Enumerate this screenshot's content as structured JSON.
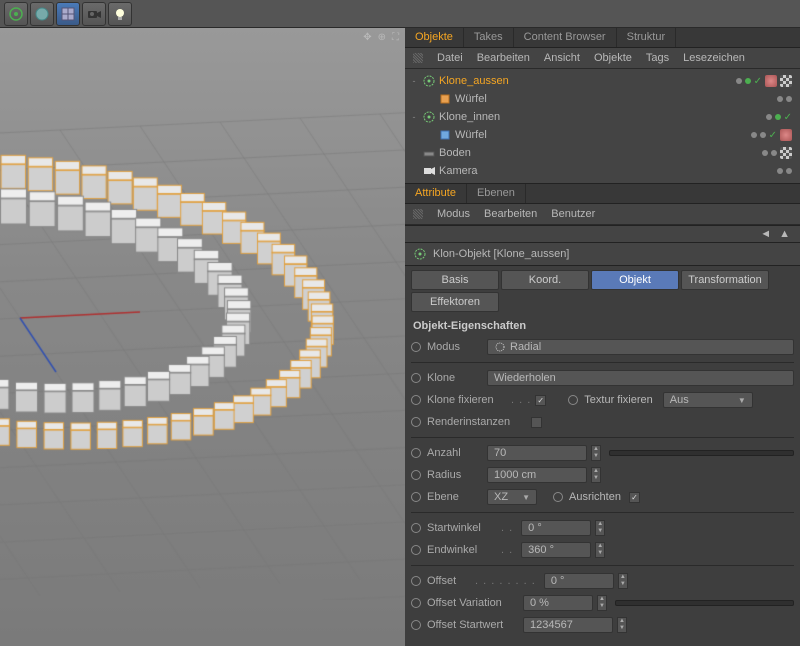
{
  "toolbar_icons": [
    "atom-icon",
    "sphere-icon",
    "grid-icon",
    "camera-icon",
    "light-icon"
  ],
  "tabs_objects": [
    "Objekte",
    "Takes",
    "Content Browser",
    "Struktur"
  ],
  "tabs_objects_active": 0,
  "obj_menu": [
    "Datei",
    "Bearbeiten",
    "Ansicht",
    "Objekte",
    "Tags",
    "Lesezeichen"
  ],
  "tree": [
    {
      "indent": 0,
      "toggle": "-",
      "icon": "cloner",
      "label": "Klone_aussen",
      "sel": true,
      "ctrl": [
        "gray",
        "green",
        "check"
      ],
      "tags": [
        "coffee",
        "checker"
      ]
    },
    {
      "indent": 1,
      "toggle": "",
      "icon": "cube-orange",
      "label": "Würfel",
      "sel": false,
      "ctrl": [
        "gray",
        "gray"
      ],
      "tags": []
    },
    {
      "indent": 0,
      "toggle": "-",
      "icon": "cloner",
      "label": "Klone_innen",
      "sel": false,
      "ctrl": [
        "gray",
        "green",
        "check"
      ],
      "tags": []
    },
    {
      "indent": 1,
      "toggle": "",
      "icon": "cube-blue",
      "label": "Würfel",
      "sel": false,
      "ctrl": [
        "gray",
        "gray",
        "check"
      ],
      "tags": [
        "coffee"
      ]
    },
    {
      "indent": 0,
      "toggle": "",
      "icon": "floor",
      "label": "Boden",
      "sel": false,
      "ctrl": [
        "gray",
        "gray"
      ],
      "tags": [
        "checker"
      ]
    },
    {
      "indent": 0,
      "toggle": "",
      "icon": "camera",
      "label": "Kamera",
      "sel": false,
      "ctrl": [
        "gray",
        "gray"
      ],
      "tags": []
    }
  ],
  "attr_tabs": [
    "Attribute",
    "Ebenen"
  ],
  "attr_tabs_active": 0,
  "attr_menu": [
    "Modus",
    "Bearbeiten",
    "Benutzer"
  ],
  "obj_header": "Klon-Objekt [Klone_aussen]",
  "prop_tabs": [
    "Basis",
    "Koord.",
    "Objekt",
    "Transformation",
    "Effektoren"
  ],
  "prop_tabs_active": 2,
  "section": "Objekt-Eigenschaften",
  "props": {
    "modus": {
      "label": "Modus",
      "value": "Radial"
    },
    "klone": {
      "label": "Klone",
      "value": "Wiederholen"
    },
    "klone_fix": {
      "label": "Klone fixieren",
      "checked": true
    },
    "textur_fix": {
      "label": "Textur fixieren",
      "value": "Aus"
    },
    "renderinst": {
      "label": "Renderinstanzen",
      "checked": false
    },
    "anzahl": {
      "label": "Anzahl",
      "value": "70"
    },
    "radius": {
      "label": "Radius",
      "value": "1000 cm"
    },
    "ebene": {
      "label": "Ebene",
      "value": "XZ"
    },
    "ausrichten": {
      "label": "Ausrichten",
      "checked": true
    },
    "startwinkel": {
      "label": "Startwinkel",
      "value": "0 °"
    },
    "endwinkel": {
      "label": "Endwinkel",
      "value": "360 °"
    },
    "offset": {
      "label": "Offset",
      "value": "0 °"
    },
    "offset_var": {
      "label": "Offset Variation",
      "value": "0 %"
    },
    "offset_start": {
      "label": "Offset Startwert",
      "value": "1234567"
    }
  }
}
